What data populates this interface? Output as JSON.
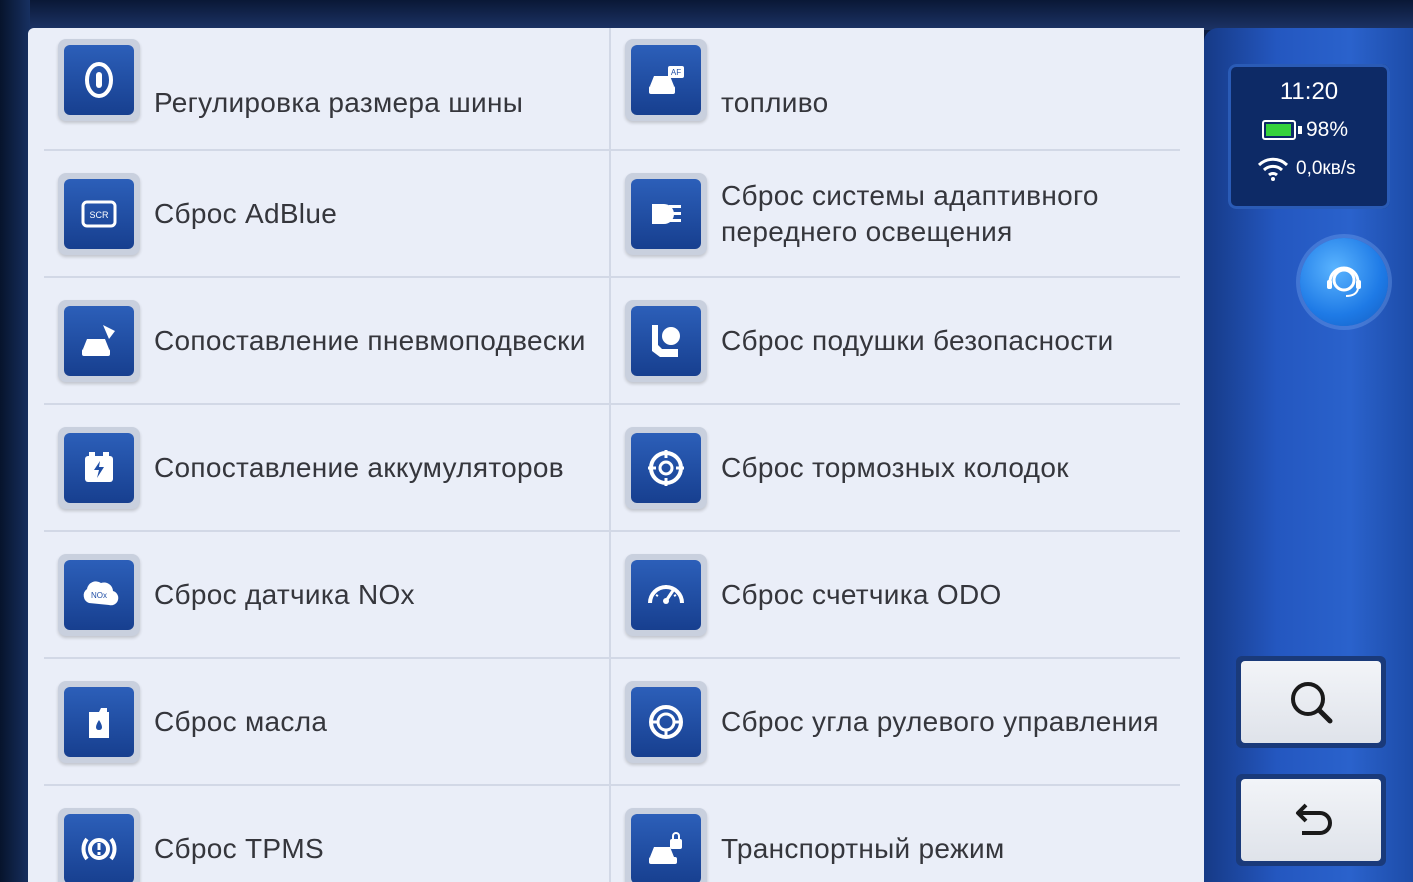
{
  "status": {
    "time": "11:20",
    "battery": "98%",
    "battery_level": 0.98,
    "network_speed": "0,0кв/s"
  },
  "colors": {
    "icon_tile": "#1f4ea6",
    "sidebar": "#2457c0",
    "battery_fill": "#37d23c",
    "assist_button": "#1e7ae6"
  },
  "functions": {
    "left": [
      {
        "label": "Регулировка размера шины",
        "icon": "tire-size-icon"
      },
      {
        "label": "Сброс AdBlue",
        "icon": "scr-adblue-icon"
      },
      {
        "label": "Сопоставление пневмоподвески",
        "icon": "air-suspension-icon"
      },
      {
        "label": "Сопоставление аккумуляторов",
        "icon": "battery-match-icon"
      },
      {
        "label": "Сброс датчика NOx",
        "icon": "nox-sensor-icon"
      },
      {
        "label": "Сброс масла",
        "icon": "oil-reset-icon"
      },
      {
        "label": "Сброс TPMS",
        "icon": "tpms-icon"
      }
    ],
    "right": [
      {
        "label": "топливо",
        "icon": "air-fuel-ratio-icon"
      },
      {
        "label": "Сброс системы адаптивного переднего освещения",
        "icon": "headlight-icon"
      },
      {
        "label": "Сброс подушки безопасности",
        "icon": "airbag-icon"
      },
      {
        "label": "Сброс тормозных колодок",
        "icon": "brake-pad-icon"
      },
      {
        "label": "Сброс счетчика ODO",
        "icon": "odometer-icon"
      },
      {
        "label": "Сброс угла рулевого управления",
        "icon": "steering-angle-icon"
      },
      {
        "label": "Транспортный режим",
        "icon": "transport-mode-icon"
      }
    ]
  },
  "sidebar": {
    "assist_icon": "customer-support-icon",
    "search_icon": "search-icon",
    "back_icon": "back-arrow-icon"
  }
}
